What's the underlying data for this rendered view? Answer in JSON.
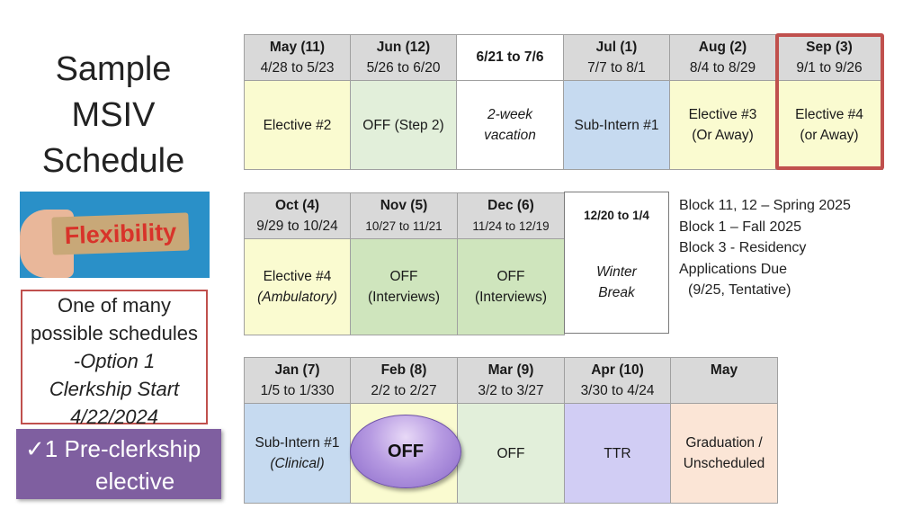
{
  "title": {
    "line1": "Sample",
    "line2": "MSIV",
    "line3": "Schedule"
  },
  "flex_image": {
    "text": "Flexibility"
  },
  "note": {
    "line1": "One of many",
    "line2": "possible schedules",
    "line3": "-Option 1",
    "line4": "Clerkship Start",
    "line5": "4/22/2024"
  },
  "callout": {
    "check": "✓",
    "line1": "1 Pre-clerkship",
    "line2": "elective"
  },
  "row1": [
    {
      "month": "May (11)",
      "dates": "4/28 to 5/23",
      "activity": "Elective #2"
    },
    {
      "month": "Jun (12)",
      "dates": "5/26 to 6/20",
      "activity": "OFF (Step 2)"
    },
    {
      "month": "6/21 to 7/6",
      "activity_l1": "2-week",
      "activity_l2": "vacation"
    },
    {
      "month": "Jul (1)",
      "dates": "7/7 to 8/1",
      "activity": "Sub-Intern #1"
    },
    {
      "month": "Aug (2)",
      "dates": "8/4 to 8/29",
      "activity_l1": "Elective #3",
      "activity_l2": "(Or Away)"
    },
    {
      "month": "Sep (3)",
      "dates": "9/1 to 9/26",
      "activity_l1": "Elective #4",
      "activity_l2": "(or Away)"
    }
  ],
  "row2": [
    {
      "month": "Oct (4)",
      "dates": "9/29 to 10/24",
      "activity_l1": "Elective #4",
      "activity_l2": "(Ambulatory)"
    },
    {
      "month": "Nov (5)",
      "dates": "10/27 to 11/21",
      "activity_l1": "OFF",
      "activity_l2": "(Interviews)"
    },
    {
      "month": "Dec (6)",
      "dates": "11/24 to 12/19",
      "activity_l1": "OFF",
      "activity_l2": "(Interviews)"
    }
  ],
  "winter": {
    "dates": "12/20 to 1/4",
    "line1": "Winter",
    "line2": "Break"
  },
  "side_notes": {
    "line1": "Block 11, 12 – Spring 2025",
    "line2": "Block 1 – Fall 2025",
    "line3": "Block 3 - Residency",
    "line4": "Applications Due",
    "line5": "(9/25,    Tentative)"
  },
  "row3": [
    {
      "month": "Jan (7)",
      "dates": "1/5 to 1/330",
      "activity_l1": "Sub-Intern #1",
      "activity_l2": "(Clinical)"
    },
    {
      "month": "Feb (8)",
      "dates": "2/2 to 2/27",
      "activity": "OFF"
    },
    {
      "month": "Mar (9)",
      "dates": "3/2 to 3/27",
      "activity": "OFF"
    },
    {
      "month": "Apr (10)",
      "dates": "3/30 to 4/24",
      "activity": "TTR"
    },
    {
      "month": "May",
      "dates": "",
      "activity_l1": "Graduation /",
      "activity_l2": "Unscheduled"
    }
  ],
  "colors": {
    "highlight_border": "#c0504d",
    "header_gray": "#d9d9d9",
    "elective_yellow": "#fafbd0",
    "off_green": "#e2efda",
    "interview_green": "#cfe5bd",
    "subintern_blue": "#c6daf0",
    "ttr_lavender": "#d1cdf4",
    "graduation_peach": "#fbe5d6",
    "callout_purple": "#7f5fa0"
  }
}
